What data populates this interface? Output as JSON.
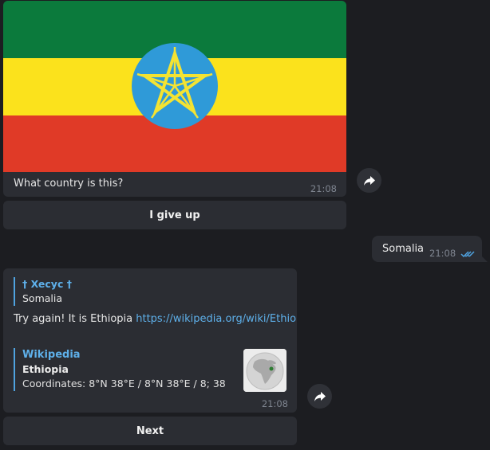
{
  "photo_message": {
    "caption": "What country is this?",
    "time": "21:08"
  },
  "buttons": {
    "give_up": "I give up",
    "next": "Next"
  },
  "outgoing": {
    "text": "Somalia",
    "time": "21:08"
  },
  "reply_message": {
    "quote_author": "† Xecyc †",
    "quote_text": "Somalia",
    "text_prefix": "Try again! It is Ethiopia",
    "link": "https://wikipedia.org/wiki/Ethiopia",
    "preview_site": "Wikipedia",
    "preview_title": "Ethiopia",
    "preview_desc": "Coordinates: 8°N 38°E / 8°N 38°E / 8; 38",
    "time": "21:08"
  },
  "icons": {
    "share": "share-arrow-icon",
    "read_ticks": "double-check-icon"
  },
  "colors": {
    "flag_green": "#0b7a3c",
    "flag_yellow": "#fbe21c",
    "flag_red": "#e03a27",
    "emblem_blue": "#2f9ad8",
    "link": "#5eb0ea",
    "bubble": "#2b2d33"
  }
}
